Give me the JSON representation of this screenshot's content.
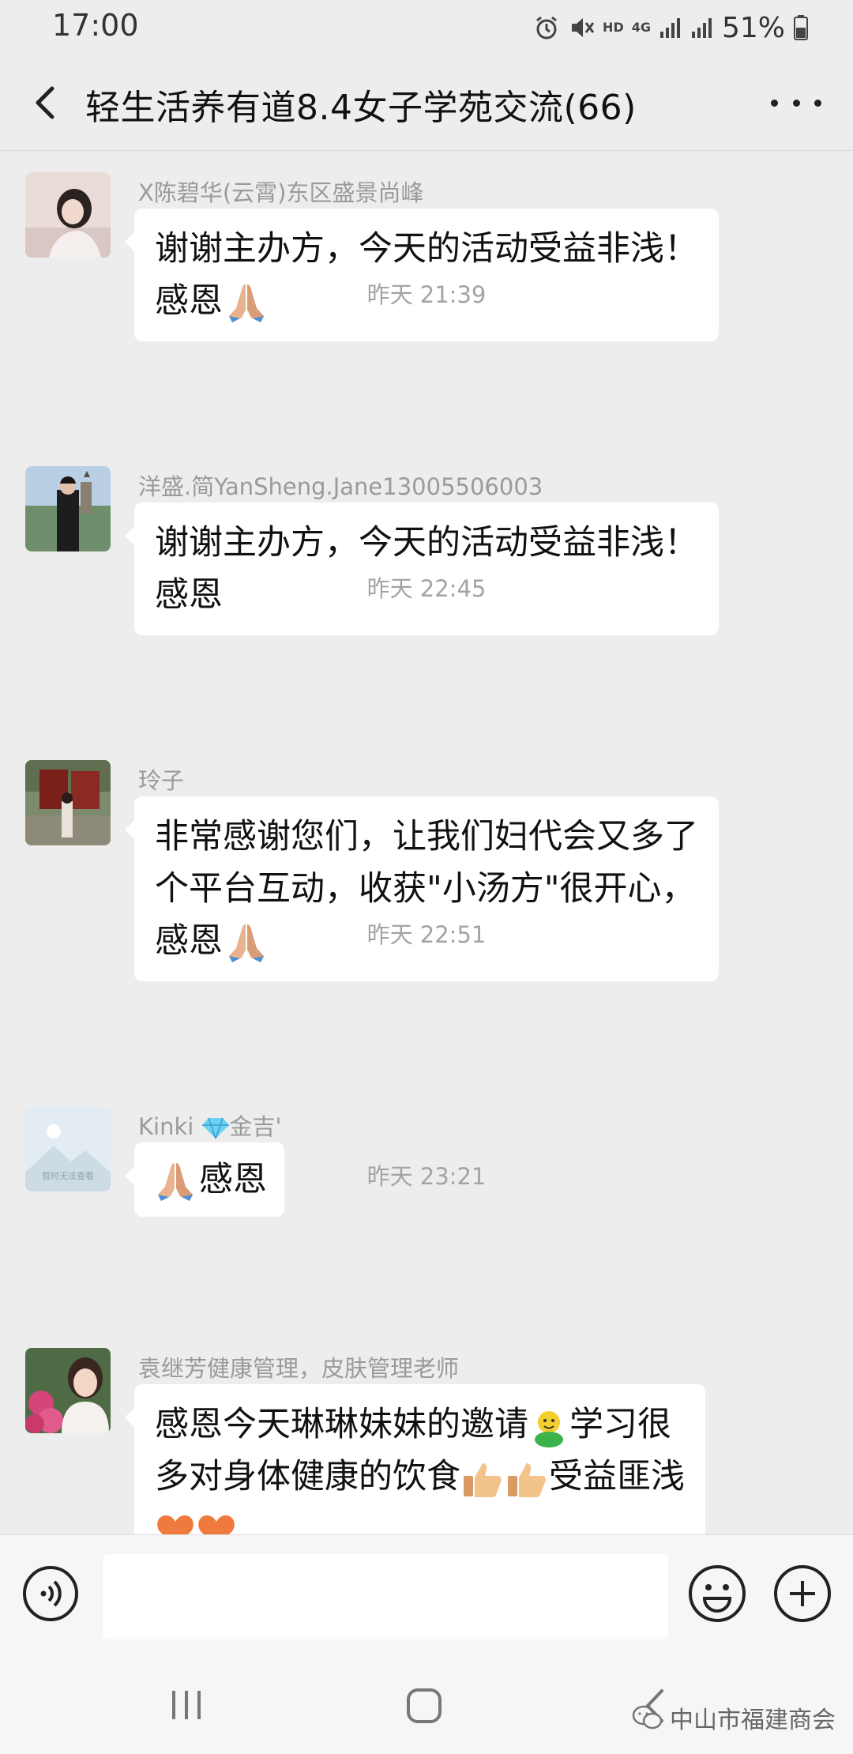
{
  "status_bar": {
    "time": "17:00",
    "network": "4G",
    "hd": "HD",
    "battery": "51%"
  },
  "header": {
    "title": "轻生活养有道8.4女子学苑交流(66)"
  },
  "colors": {
    "background": "#ededed",
    "bubble": "#ffffff",
    "timestamp": "#a3a3a3",
    "sender": "#9a9a9a"
  },
  "messages": [
    {
      "sender": "X陈碧华(云霄)东区盛景尚峰",
      "lines": [
        "谢谢主办方，今天的活动受益非浅！",
        "感恩"
      ],
      "emoji": "folded-hands"
    },
    {
      "timestamp": "昨天 21:39"
    },
    {
      "sender": "洋盛.简YanSheng.Jane13005506003",
      "lines": [
        "谢谢主办方，今天的活动受益非浅！",
        "感恩"
      ]
    },
    {
      "timestamp": "昨天 22:45"
    },
    {
      "sender": "玲子",
      "lines": [
        "非常感谢您们，让我们妇代会又多了",
        "个平台互动，收获\"小汤方\"很开心，",
        "感恩"
      ],
      "emoji": "folded-hands"
    },
    {
      "timestamp": "昨天 22:51"
    },
    {
      "sender": "Kinki",
      "sender_suffix": "金吉'",
      "lines": [
        "感恩"
      ],
      "emoji": "folded-hands"
    },
    {
      "timestamp": "昨天 23:21"
    },
    {
      "sender": "袁继芳健康管理，皮肤管理老师",
      "lines": [
        "感恩今天琳琳妹妹的邀请",
        "学习很",
        "多对身体健康的饮食",
        "受益匪浅"
      ]
    }
  ],
  "avatar_placeholder_text": "暂时无法查看",
  "watermark": "中山市福建商会"
}
